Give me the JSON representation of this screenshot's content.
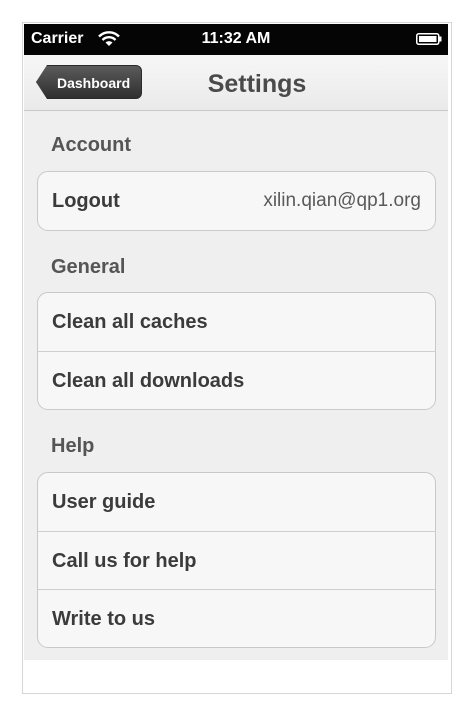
{
  "status_bar": {
    "carrier": "Carrier",
    "time": "11:32 AM",
    "wifi_icon": "wifi-icon",
    "battery_icon": "battery-icon"
  },
  "nav": {
    "back_label": "Dashboard",
    "title": "Settings"
  },
  "sections": {
    "account": {
      "header": "Account",
      "rows": [
        {
          "label": "Logout",
          "detail": "xilin.qian@qp1.org"
        }
      ]
    },
    "general": {
      "header": "General",
      "rows": [
        {
          "label": "Clean all caches"
        },
        {
          "label": "Clean all downloads"
        }
      ]
    },
    "help": {
      "header": "Help",
      "rows": [
        {
          "label": "User guide"
        },
        {
          "label": "Call us for help"
        },
        {
          "label": "Write to us"
        }
      ]
    }
  },
  "colors": {
    "status_bar": "#050505",
    "background": "#efefef",
    "back_button": "#3e3e3e",
    "cell_background": "#f7f7f7"
  }
}
